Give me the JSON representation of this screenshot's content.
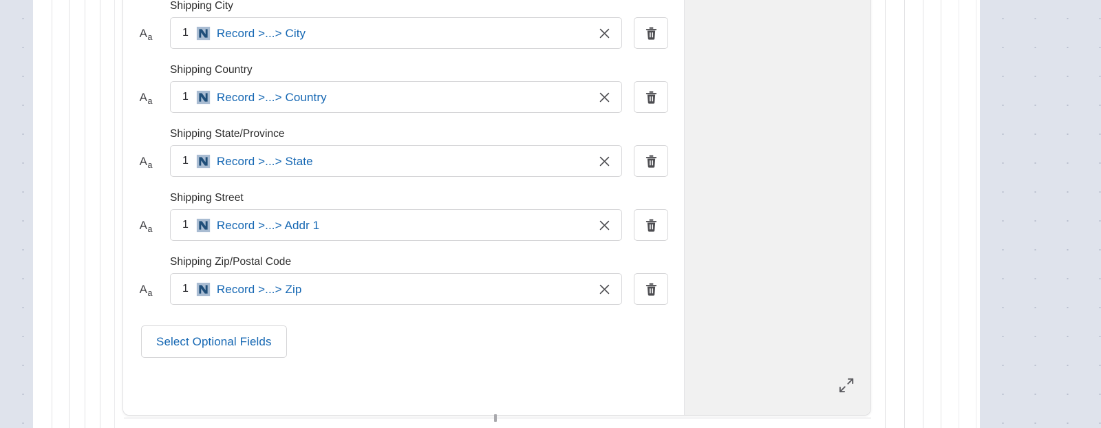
{
  "drawer": {
    "fields": [
      {
        "label": "Shipping City",
        "type_icon": "text-type-icon",
        "type_icon_primary": "A",
        "type_icon_secondary": "a",
        "token_index": "1",
        "token_logo": "netsuite-n-logo-icon",
        "token_text": "Record >...> City",
        "clear_icon": "close-icon",
        "delete_icon": "trash-icon"
      },
      {
        "label": "Shipping Country",
        "type_icon": "text-type-icon",
        "type_icon_primary": "A",
        "type_icon_secondary": "a",
        "token_index": "1",
        "token_logo": "netsuite-n-logo-icon",
        "token_text": "Record >...> Country",
        "clear_icon": "close-icon",
        "delete_icon": "trash-icon"
      },
      {
        "label": "Shipping State/Province",
        "type_icon": "text-type-icon",
        "type_icon_primary": "A",
        "type_icon_secondary": "a",
        "token_index": "1",
        "token_logo": "netsuite-n-logo-icon",
        "token_text": "Record >...> State",
        "clear_icon": "close-icon",
        "delete_icon": "trash-icon"
      },
      {
        "label": "Shipping Street",
        "type_icon": "text-type-icon",
        "type_icon_primary": "A",
        "type_icon_secondary": "a",
        "token_index": "1",
        "token_logo": "netsuite-n-logo-icon",
        "token_text": "Record >...> Addr 1",
        "clear_icon": "close-icon",
        "delete_icon": "trash-icon"
      },
      {
        "label": "Shipping Zip/Postal Code",
        "type_icon": "text-type-icon",
        "type_icon_primary": "A",
        "type_icon_secondary": "a",
        "token_index": "1",
        "token_logo": "netsuite-n-logo-icon",
        "token_text": "Record >...> Zip",
        "clear_icon": "close-icon",
        "delete_icon": "trash-icon"
      }
    ],
    "optional_fields_button": "Select Optional Fields",
    "expand_icon": "expand-diagonal-icon"
  },
  "colors": {
    "link_blue": "#1567b3",
    "logo_navy": "#1f4e79",
    "logo_light": "#a9bcd2",
    "label_text": "#2b2b2b",
    "border": "#d6d6d8",
    "preview_bg": "#f1f1f1",
    "canvas_dots": "#dfe3ec"
  }
}
